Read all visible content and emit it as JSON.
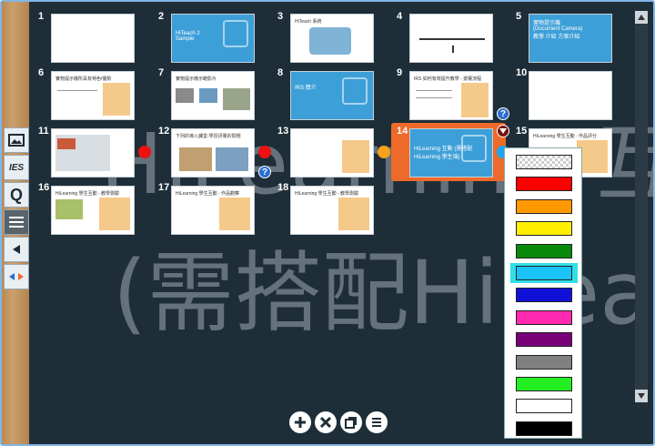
{
  "slides": [
    {
      "num": "1",
      "title": ""
    },
    {
      "num": "2",
      "title": "HiTeach 2 Sample"
    },
    {
      "num": "3",
      "title": "HiTeach 系統"
    },
    {
      "num": "4",
      "title": ""
    },
    {
      "num": "5",
      "title": "實物提示機 (Document Camera) 教學 介紹 方案介紹"
    },
    {
      "num": "6",
      "title": "實物提示機所具有特色/優勢"
    },
    {
      "num": "7",
      "title": "實物提示機示範影片"
    },
    {
      "num": "8",
      "title": "IRS 簡介"
    },
    {
      "num": "9",
      "title": "IRS 如何有效提升教學 - 搶權流程"
    },
    {
      "num": "10",
      "title": ""
    },
    {
      "num": "11",
      "title": ""
    },
    {
      "num": "12",
      "title": "下列的導入課堂-學習評量的問題"
    },
    {
      "num": "13",
      "title": ""
    },
    {
      "num": "14",
      "title": "HiLearning 互動 (需搭配HiLearning 學生端)"
    },
    {
      "num": "15",
      "title": "HiLearning 學生互動 - 作品評分"
    },
    {
      "num": "16",
      "title": "HiLearning 學生互動 - 教學測驗"
    },
    {
      "num": "17",
      "title": "HiLearning 學生互動 - 作品觀察"
    },
    {
      "num": "18",
      "title": "HiLearning 學生互動 - 教學測驗"
    }
  ],
  "watermark": {
    "line1": "HiLearning 互",
    "line2": "(需搭配HiLea"
  },
  "help_glyph": "?",
  "left_toolbar": {
    "ies_label": "IES",
    "q_label": "Q"
  },
  "palette_colors": [
    "transparent",
    "#ff0000",
    "#ff9900",
    "#ffee00",
    "#0a8a0a",
    "#19c3f5",
    "#1010d8",
    "#ff2ab0",
    "#7a007a",
    "#808080",
    "#22ee22",
    "#ffffff",
    "#000000"
  ],
  "palette_selected_index": 5,
  "slide_dots": {
    "s11": "#ee1111",
    "s12": "#ee1111",
    "s13": "#f7a21b",
    "s14": "#19a8f0"
  },
  "accent": "#ee6a2a"
}
